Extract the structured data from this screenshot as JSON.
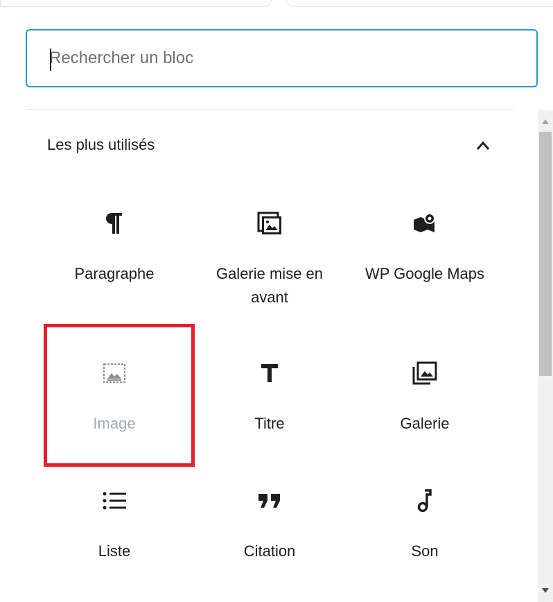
{
  "search": {
    "placeholder": "Rechercher un bloc"
  },
  "section": {
    "title": "Les plus utilisés",
    "toggle_icon": "chevron-up-icon"
  },
  "blocks": [
    {
      "label": "Paragraphe",
      "icon": "paragraph-icon"
    },
    {
      "label": "Galerie mise en avant",
      "icon": "featured-gallery-icon"
    },
    {
      "label": "WP Google Maps",
      "icon": "map-marker-icon"
    },
    {
      "label": "Image",
      "icon": "image-icon"
    },
    {
      "label": "Titre",
      "icon": "heading-icon"
    },
    {
      "label": "Galerie",
      "icon": "gallery-icon"
    },
    {
      "label": "Liste",
      "icon": "list-icon"
    },
    {
      "label": "Citation",
      "icon": "quote-icon"
    },
    {
      "label": "Son",
      "icon": "audio-icon"
    }
  ],
  "colors": {
    "focus_border": "#1ea0c9",
    "highlight_border": "#e5202a",
    "text": "#1e1e1e",
    "muted_text": "#a2aab2"
  }
}
